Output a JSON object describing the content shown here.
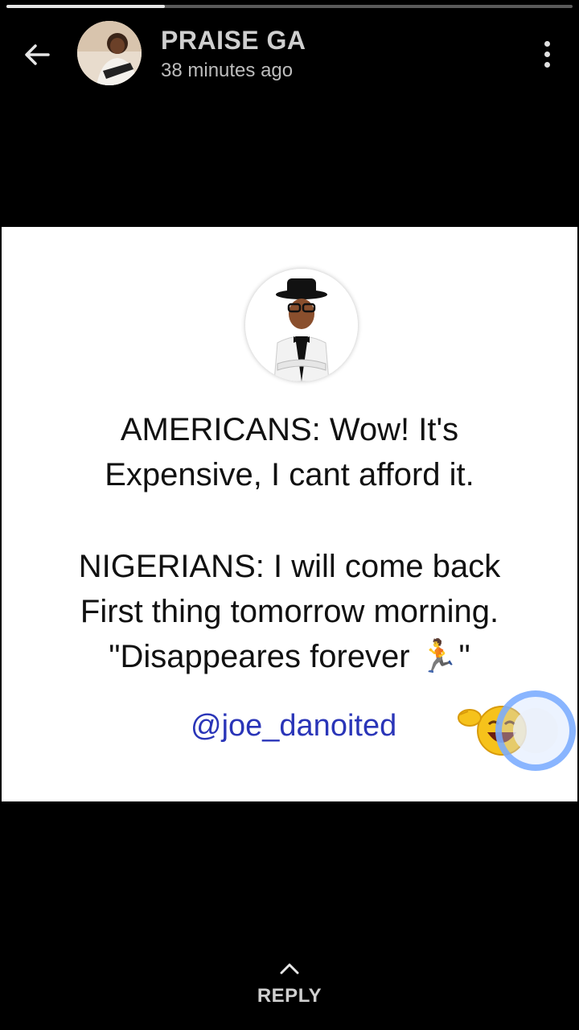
{
  "header": {
    "name": "PRAISE GA",
    "time": "38 minutes ago",
    "progress": 0.28
  },
  "status": {
    "lines": [
      "AMERICANS: Wow!  It's",
      "Expensive, I cant afford it.",
      "",
      "NIGERIANS: I will come back",
      "First thing tomorrow morning.",
      "\"Disappeares forever 🏃\""
    ],
    "handle": "@joe_danoited"
  },
  "footer": {
    "reply_label": "REPLY"
  },
  "colors": {
    "background": "#000000",
    "handle": "#2a35b8",
    "tap_ring": "#78aaff"
  },
  "icons": [
    "back-arrow-icon",
    "more-vert-icon",
    "chevron-up-icon"
  ]
}
